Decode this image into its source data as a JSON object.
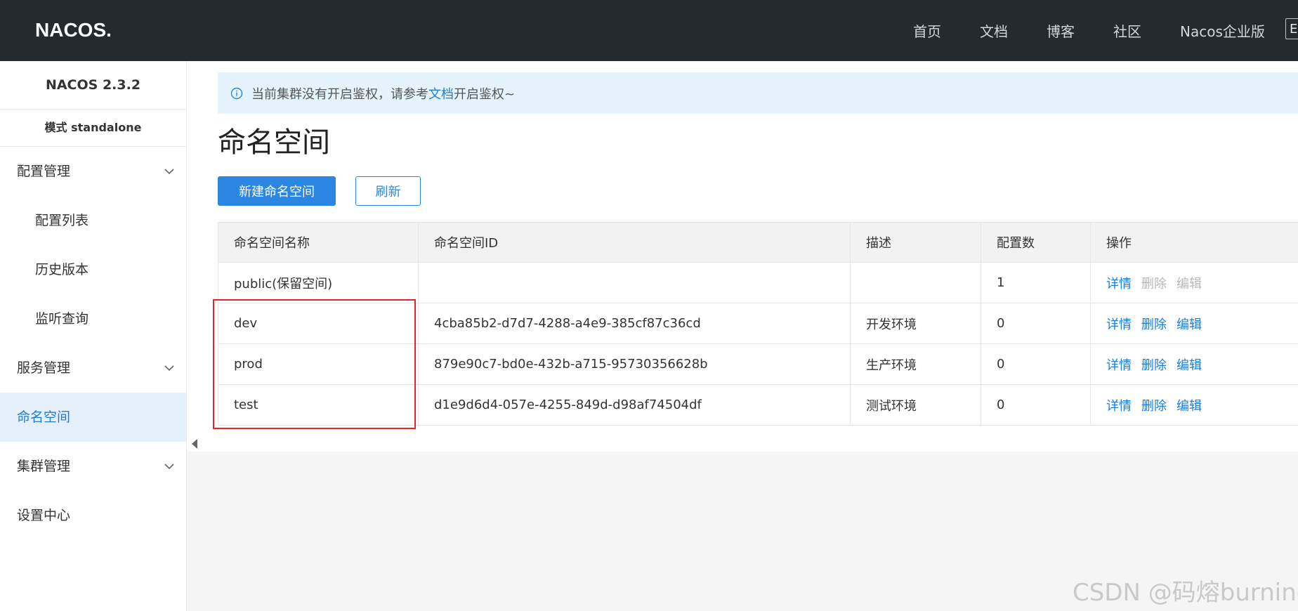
{
  "header": {
    "logo_text": "NACOS.",
    "nav": [
      "首页",
      "文档",
      "博客",
      "社区",
      "Nacos企业版"
    ],
    "lang_button": "E"
  },
  "sidebar": {
    "version": "NACOS 2.3.2",
    "mode": "模式 standalone",
    "menu": [
      {
        "label": "配置管理",
        "type": "group",
        "expanded": true
      },
      {
        "label": "配置列表",
        "type": "sub"
      },
      {
        "label": "历史版本",
        "type": "sub"
      },
      {
        "label": "监听查询",
        "type": "sub"
      },
      {
        "label": "服务管理",
        "type": "group",
        "expanded": false
      },
      {
        "label": "命名空间",
        "type": "item",
        "active": true
      },
      {
        "label": "集群管理",
        "type": "group",
        "expanded": false
      },
      {
        "label": "设置中心",
        "type": "item"
      }
    ]
  },
  "notice": {
    "text_before": "当前集群没有开启鉴权，请参考",
    "link": "文档",
    "text_after": "开启鉴权~"
  },
  "page": {
    "title": "命名空间",
    "create_button": "新建命名空间",
    "refresh_button": "刷新"
  },
  "table": {
    "columns": [
      "命名空间名称",
      "命名空间ID",
      "描述",
      "配置数",
      "操作"
    ],
    "rows": [
      {
        "name": "public(保留空间)",
        "id": "",
        "desc": "",
        "count": "1",
        "ops": [
          {
            "label": "详情",
            "enabled": true
          },
          {
            "label": "删除",
            "enabled": false
          },
          {
            "label": "编辑",
            "enabled": false
          }
        ]
      },
      {
        "name": "dev",
        "id": "4cba85b2-d7d7-4288-a4e9-385cf87c36cd",
        "desc": "开发环境",
        "count": "0",
        "ops": [
          {
            "label": "详情",
            "enabled": true
          },
          {
            "label": "删除",
            "enabled": true
          },
          {
            "label": "编辑",
            "enabled": true
          }
        ]
      },
      {
        "name": "prod",
        "id": "879e90c7-bd0e-432b-a715-95730356628b",
        "desc": "生产环境",
        "count": "0",
        "ops": [
          {
            "label": "详情",
            "enabled": true
          },
          {
            "label": "删除",
            "enabled": true
          },
          {
            "label": "编辑",
            "enabled": true
          }
        ]
      },
      {
        "name": "test",
        "id": "d1e9d6d4-057e-4255-849d-d98af74504df",
        "desc": "测试环境",
        "count": "0",
        "ops": [
          {
            "label": "详情",
            "enabled": true
          },
          {
            "label": "删除",
            "enabled": true
          },
          {
            "label": "编辑",
            "enabled": true
          }
        ]
      }
    ]
  },
  "watermark": "CSDN @码熔burning",
  "colors": {
    "topbar": "#252a2f",
    "accent": "#2a86e0",
    "link": "#1d7dd4",
    "active_bg": "#e5f0fb",
    "notice_bg": "#e5f3fd",
    "highlight": "#e0262b",
    "disabled": "#b8b8b8"
  }
}
